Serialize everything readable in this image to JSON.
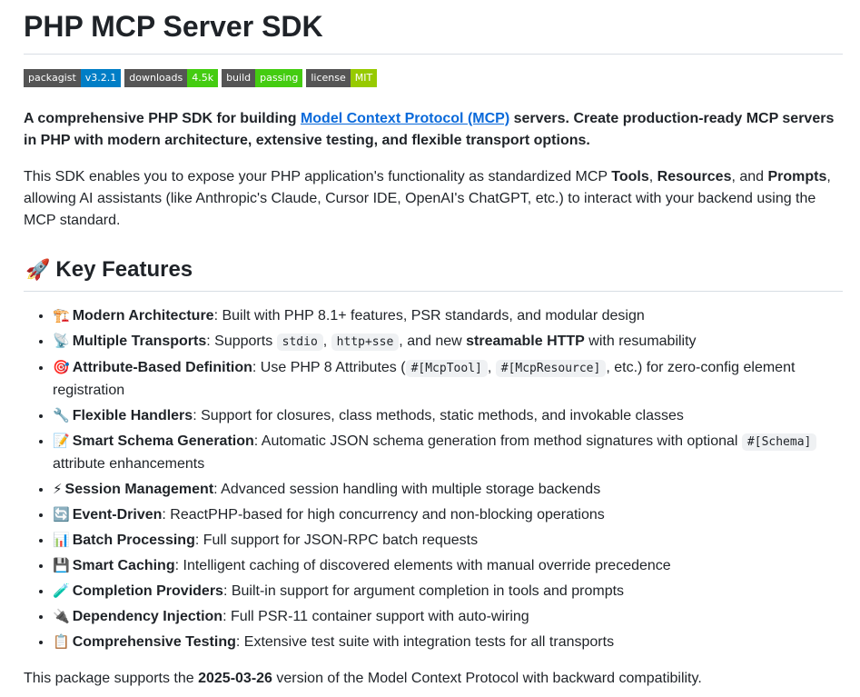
{
  "title": "PHP MCP Server SDK",
  "badges": [
    {
      "label": "packagist",
      "value": "v3.2.1",
      "color": "#007ec6"
    },
    {
      "label": "downloads",
      "value": "4.5k",
      "color": "#4c1"
    },
    {
      "label": "build",
      "value": "passing",
      "color": "#4c1"
    },
    {
      "label": "license",
      "value": "MIT",
      "color": "#97ca00"
    }
  ],
  "intro": {
    "prefix": "A comprehensive PHP SDK for building ",
    "link": "Model Context Protocol (MCP)",
    "suffix": " servers. Create production-ready MCP servers in PHP with modern architecture, extensive testing, and flexible transport options."
  },
  "desc": {
    "t1": "This SDK enables you to expose your PHP application's functionality as standardized MCP ",
    "b1": "Tools",
    "t2": ", ",
    "b2": "Resources",
    "t3": ", and ",
    "b3": "Prompts",
    "t4": ", allowing AI assistants (like Anthropic's Claude, Cursor IDE, OpenAI's ChatGPT, etc.) to interact with your backend using the MCP standard."
  },
  "features_heading": {
    "emoji": "🚀",
    "text": "Key Features"
  },
  "features": [
    {
      "emoji": "🏗️",
      "title": "Modern Architecture",
      "text": ": Built with PHP 8.1+ features, PSR standards, and modular design"
    },
    {
      "emoji": "📡",
      "title": "Multiple Transports",
      "t1": ": Supports ",
      "c1": "stdio",
      "t2": ", ",
      "c2": "http+sse",
      "t3": ", and new ",
      "b": "streamable HTTP",
      "t4": " with resumability"
    },
    {
      "emoji": "🎯",
      "title": "Attribute-Based Definition",
      "t1": ": Use PHP 8 Attributes (",
      "c1": "#[McpTool]",
      "t2": ", ",
      "c2": "#[McpResource]",
      "t3": ", etc.) for zero-config element registration"
    },
    {
      "emoji": "🔧",
      "title": "Flexible Handlers",
      "text": ": Support for closures, class methods, static methods, and invokable classes"
    },
    {
      "emoji": "📝",
      "title": "Smart Schema Generation",
      "t1": ": Automatic JSON schema generation from method signatures with optional ",
      "c1": "#[Schema]",
      "t2": " attribute enhancements"
    },
    {
      "emoji": "⚡",
      "title": "Session Management",
      "text": ": Advanced session handling with multiple storage backends"
    },
    {
      "emoji": "🔄",
      "title": "Event-Driven",
      "text": ": ReactPHP-based for high concurrency and non-blocking operations"
    },
    {
      "emoji": "📊",
      "title": "Batch Processing",
      "text": ": Full support for JSON-RPC batch requests"
    },
    {
      "emoji": "💾",
      "title": "Smart Caching",
      "text": ": Intelligent caching of discovered elements with manual override precedence"
    },
    {
      "emoji": "🧪",
      "title": "Completion Providers",
      "text": ": Built-in support for argument completion in tools and prompts"
    },
    {
      "emoji": "🔌",
      "title": "Dependency Injection",
      "text": ": Full PSR-11 container support with auto-wiring"
    },
    {
      "emoji": "📋",
      "title": "Comprehensive Testing",
      "text": ": Extensive test suite with integration tests for all transports"
    }
  ],
  "footer": {
    "t1": "This package supports the ",
    "b": "2025-03-26",
    "t2": " version of the Model Context Protocol with backward compatibility."
  }
}
